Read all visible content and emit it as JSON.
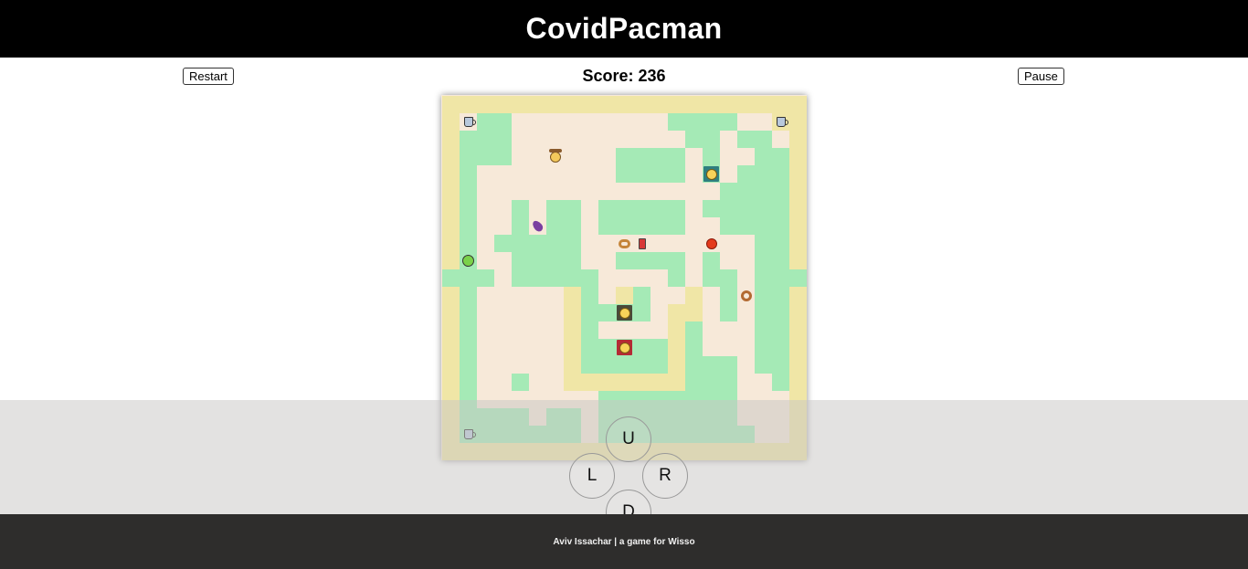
{
  "app": {
    "title": "CovidPacman"
  },
  "toolbar": {
    "restart_label": "Restart",
    "pause_label": "Pause",
    "score_label": "Score: 236"
  },
  "board": {
    "cols": 21,
    "rows": 21,
    "colors": {
      "floor": "#f7e9d9",
      "wall": "#a5eab6",
      "border": "#f0e6a6"
    },
    "walls": [
      "BBBBBBBBBBBBBBBBBBBBB",
      "B.WW.........WWWW..BB",
      "BWWW..........WW.WW.B",
      "BWWW......WWWW.W..WWB",
      "BW........WWWW.W.WWWB",
      "BW..............WWWWB",
      "BW..W.WW.WWWWW.WWWWWB",
      "BW..W.WW.WWWWW..WWWWB",
      "BW.WWWWW..........WWB",
      "BW..WWWW..WWWW.W..WWB",
      "WWW.WWWWW....W.WW.WWW",
      "BW.....BW.BW..B.W.WWB",
      "BW.....BWWWW.BB.W.WWB",
      "BW.....BW....BW...WWB",
      "BW.....BWWWWWBW...WWB",
      "BW.....BWWWWWBWWW.WWB",
      "BW..W..BBBBBBBWWW..WB",
      "BW.......WWWWWWWW...B",
      "BWWWW.WW.WWWWWWWW...B",
      "BWWWWWWW.WWWWWWWWW..B",
      "BBBBBBBBBBBBBBBBBBBBB"
    ],
    "items": [
      {
        "type": "mug-icon",
        "col": 1,
        "row": 1
      },
      {
        "type": "mug-icon",
        "col": 19,
        "row": 1
      },
      {
        "type": "cowboy-icon",
        "col": 6,
        "row": 3
      },
      {
        "type": "eggplant-icon",
        "col": 5,
        "row": 7
      },
      {
        "type": "pretzel-icon",
        "col": 10,
        "row": 8
      },
      {
        "type": "drink-icon",
        "col": 11,
        "row": 8
      },
      {
        "type": "tomato-icon",
        "col": 15,
        "row": 8
      },
      {
        "type": "donut-icon",
        "col": 17,
        "row": 11
      },
      {
        "type": "mug-icon",
        "col": 1,
        "row": 19
      }
    ],
    "ghosts": [
      {
        "name": "ghost-teal",
        "col": 15,
        "row": 4,
        "color": "#2f7f7f"
      },
      {
        "name": "ghost-dark",
        "col": 10,
        "row": 12,
        "color": "#4a4a3a"
      },
      {
        "name": "ghost-red",
        "col": 10,
        "row": 14,
        "color": "#b52a35"
      }
    ],
    "player": {
      "col": 1,
      "row": 9,
      "color": "#7ad14a"
    }
  },
  "controls": {
    "up_label": "U",
    "left_label": "L",
    "right_label": "R",
    "down_label": "D"
  },
  "footer": {
    "credit": "Aviv Issachar | a game for Wisso"
  }
}
